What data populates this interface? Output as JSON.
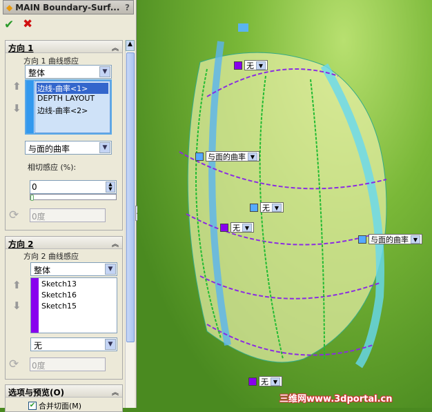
{
  "window": {
    "title": "MAIN Boundary-Surf...",
    "help": "?"
  },
  "actions": {
    "ok": "✔",
    "cancel": "✖"
  },
  "direction1": {
    "header": "方向 1",
    "label": "方向 1 曲线感应",
    "mode": "整体",
    "items": [
      "边线-曲率<1>",
      "DEPTH LAYOUT",
      "边线-曲率<2>"
    ],
    "selected": 0,
    "color": "#3399ee",
    "tangent": "与面的曲率",
    "tangent_label": "相切感应 (%):",
    "tangent_value": "0",
    "slider": 0,
    "angle": "0度"
  },
  "direction2": {
    "header": "方向 2",
    "label": "方向 2 曲线感应",
    "mode": "整体",
    "items": [
      "Sketch13",
      "Sketch16",
      "Sketch15"
    ],
    "color": "#8800ee",
    "tangent": "无",
    "angle": "0度"
  },
  "options": {
    "header": "选项与预览(O)",
    "merge": "合并切面(M)",
    "merge_checked": true
  },
  "viewport": {
    "callouts": [
      {
        "text": "无",
        "color": "#8800ee"
      },
      {
        "text": "与面的曲率",
        "color": "#55aaff"
      },
      {
        "text": "无",
        "color": "#55aaff"
      },
      {
        "text": "无",
        "color": "#8800ee"
      },
      {
        "text": "与面的曲率",
        "color": "#55aaff"
      },
      {
        "text": "无",
        "color": "#8800ee"
      }
    ]
  },
  "watermark": "三维网www.3dportal.cn"
}
